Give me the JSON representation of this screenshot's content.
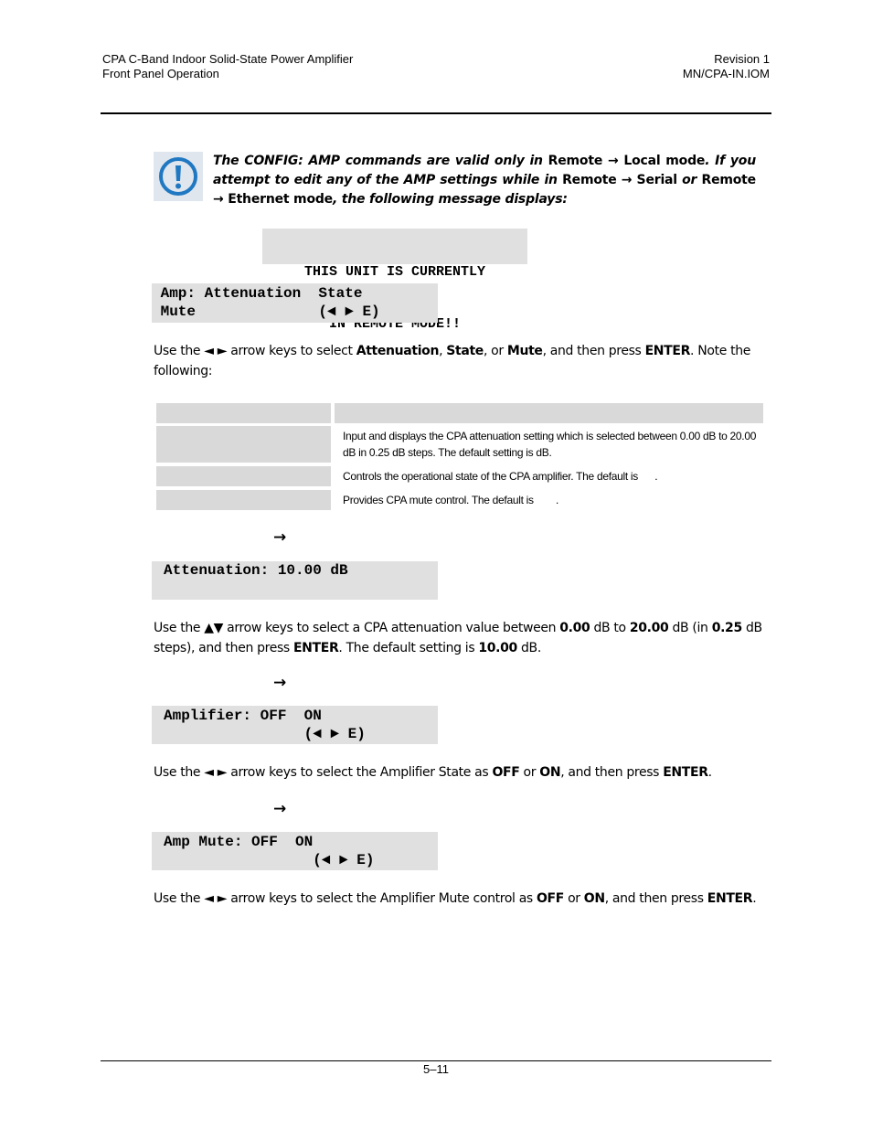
{
  "header": {
    "left_line1": "CPA C-Band Indoor Solid-State Power Amplifier",
    "left_line2": "Front Panel Operation",
    "right_line1": "Revision 1",
    "right_line2": "MN/CPA-IN.IOM"
  },
  "note": {
    "icon": "exclamation-circle-icon",
    "t1": "The CONFIG: AMP commands are valid only in ",
    "t2": "Remote → Local mode",
    "t3": ". If you attempt to edit any of the AMP settings while in ",
    "t4": "Remote → Serial",
    "t5": " or ",
    "t6": "Remote → Ethernet mode",
    "t7": ", the following message displays:"
  },
  "lcd_remote": {
    "line1": "THIS UNIT IS CURRENTLY",
    "line2": "IN REMOTE MODE!!"
  },
  "lcd_amp": {
    "line1": " Amp: Attenuation  State",
    "line2": " Mute              (◄ ► E)"
  },
  "para1": {
    "a": "Use the ◄ ►  arrow keys to select ",
    "b": "Attenuation",
    "c": ", ",
    "d": "State",
    "e": ", or ",
    "f": "Mute",
    "g": ", and then press ",
    "h": "ENTER",
    "i": ". Note the following:"
  },
  "table": {
    "header": [
      "",
      ""
    ],
    "rows": [
      {
        "label": "",
        "desc": "Input and displays the CPA attenuation setting which is selected between 0.00 dB to 20.00 dB in 0.25 dB steps. The default setting is          dB."
      },
      {
        "label": "",
        "desc": "Controls the operational state of the CPA amplifier. The default is      ."
      },
      {
        "label": "",
        "desc": "Provides CPA mute control. The default is        ."
      }
    ]
  },
  "arrow_glyph": "→",
  "lcd_att": {
    "line1": "Attenuation: 10.00 dB",
    "line2": ""
  },
  "para2": {
    "a": "Use the ▲▼ arrow keys to select a CPA attenuation value between ",
    "b": "0.00",
    "c": " dB to ",
    "d": "20.00",
    "e": " dB (in ",
    "f": "0.25",
    "g": " dB steps), and then press ",
    "h": "ENTER",
    "i": ". The default setting is ",
    "j": "10.00",
    "k": " dB."
  },
  "lcd_ampl": {
    "line1": "Amplifier: OFF  ON",
    "line2": "                (◄ ► E)"
  },
  "para3": {
    "a": "Use the ◄ ►  arrow keys to select the Amplifier State as ",
    "b": "OFF",
    "c": " or ",
    "d": "ON",
    "e": ", and then press ",
    "f": "ENTER",
    "g": "."
  },
  "lcd_mute": {
    "line1": "Amp Mute: OFF  ON",
    "line2": "                 (◄ ► E)"
  },
  "para4": {
    "a": "Use the ◄ ►  arrow keys to select the Amplifier Mute control as ",
    "b": "OFF",
    "c": " or ",
    "d": "ON",
    "e": ", and then press ",
    "f": "ENTER",
    "g": "."
  },
  "footer": {
    "page_number": "5–11"
  }
}
